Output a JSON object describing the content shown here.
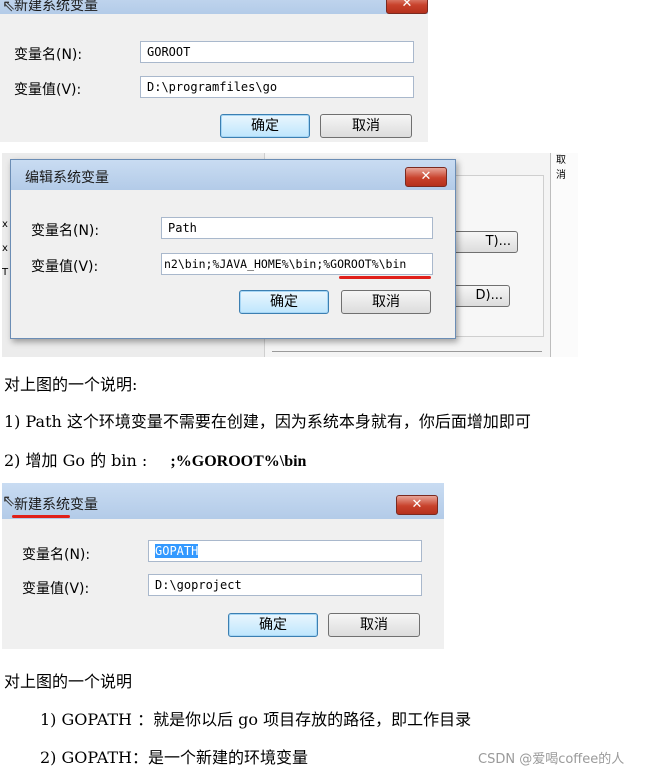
{
  "dialog1": {
    "title": "新建系统变量",
    "close_glyph": "✕",
    "name_label": "变量名(N):",
    "name_value": "GOROOT",
    "value_label": "变量值(V):",
    "value_value": "D:\\programfiles\\go",
    "ok_label": "确定",
    "cancel_label": "取消"
  },
  "dialog2": {
    "title": "编辑系统变量",
    "close_glyph": "✕",
    "name_label": "变量名(N):",
    "name_value": "Path",
    "value_label": "变量值(V):",
    "value_value": "n2\\bin;%JAVA_HOME%\\bin;%GOROOT%\\bin",
    "ok_label": "确定",
    "cancel_label": "取消",
    "bg_cancel_label": "取 消",
    "bg_btn1_label": "T)...",
    "bg_btn2_label": "D)..."
  },
  "notes1": {
    "heading": "对上图的一个说明:",
    "item1": "1) Path 这个环境变量不需要在创建，因为系统本身就有，你后面增加即可",
    "item2_prefix": "2) 增加 Go 的 bin :",
    "item2_code": ";%GOROOT%\\bin"
  },
  "dialog3": {
    "title": "新建系统变量",
    "close_glyph": "✕",
    "name_label": "变量名(N):",
    "name_value": "GOPATH",
    "value_label": "变量值(V):",
    "value_value": "D:\\goproject",
    "ok_label": "确定",
    "cancel_label": "取消"
  },
  "notes2": {
    "heading": "对上图的一个说明",
    "item1": "1)  GOPATH ：就是你以后 go 项目存放的路径，即工作目录",
    "item2": "2)  GOPATH：是一个新建的环境变量"
  },
  "watermark": "CSDN @爱喝coffee的人",
  "colors": {
    "accent": "#e0201a",
    "titlebar": "#b9d1ea",
    "close": "#c8422c"
  },
  "icons": [
    "mouse-cursor-icon",
    "close-icon"
  ]
}
